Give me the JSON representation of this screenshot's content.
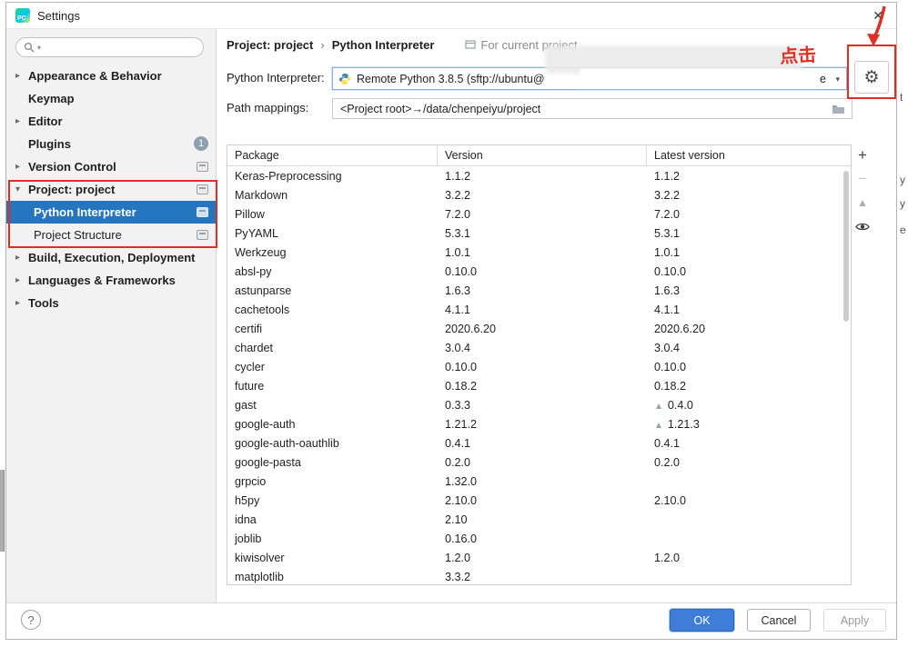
{
  "window": {
    "title": "Settings",
    "logo": "PC"
  },
  "icons": {
    "close": "✕",
    "chevron_collapsed": "▸",
    "chevron_expanded": "▾",
    "combo_arrow": "▾",
    "breadcrumb_sep": "›",
    "gear": "⚙",
    "plus": "+",
    "minus": "−",
    "upgrade": "▲"
  },
  "colors": {
    "selection_blue": "#2675bf",
    "annotation_red": "#df2f25",
    "ok_blue": "#3e7ed9"
  },
  "sidebar": {
    "search_placeholder": "",
    "items": [
      {
        "id": "appearance-behavior",
        "label": "Appearance & Behavior",
        "expandable": true,
        "bold": true
      },
      {
        "id": "keymap",
        "label": "Keymap",
        "bold": true
      },
      {
        "id": "editor",
        "label": "Editor",
        "expandable": true,
        "bold": true
      },
      {
        "id": "plugins",
        "label": "Plugins",
        "bold": true,
        "badge": "1"
      },
      {
        "id": "version-control",
        "label": "Version Control",
        "expandable": true,
        "bold": true,
        "scoped": true
      },
      {
        "id": "project-project",
        "label": "Project: project",
        "expanded": true,
        "bold": true,
        "scoped": true
      },
      {
        "id": "python-interpreter",
        "label": "Python Interpreter",
        "child": true,
        "selected": true,
        "scoped": true
      },
      {
        "id": "project-structure",
        "label": "Project Structure",
        "child": true,
        "scoped": true
      },
      {
        "id": "build-execution-deployment",
        "label": "Build, Execution, Deployment",
        "expandable": true,
        "bold": true
      },
      {
        "id": "languages-frameworks",
        "label": "Languages & Frameworks",
        "expandable": true,
        "bold": true
      },
      {
        "id": "tools",
        "label": "Tools",
        "expandable": true,
        "bold": true
      }
    ]
  },
  "header": {
    "breadcrumb": [
      "Project: project",
      "Python Interpreter"
    ],
    "context_label": "For current project"
  },
  "interpreter": {
    "label": "Python Interpreter:",
    "value": "Remote Python 3.8.5 (sftp://ubuntu@",
    "value_tail": "e"
  },
  "path_mappings": {
    "label": "Path mappings:",
    "value": "<Project root>→/data/chenpeiyu/project"
  },
  "packages": {
    "columns": [
      "Package",
      "Version",
      "Latest version"
    ],
    "rows": [
      {
        "name": "Keras-Preprocessing",
        "version": "1.1.2",
        "latest": "1.1.2"
      },
      {
        "name": "Markdown",
        "version": "3.2.2",
        "latest": "3.2.2"
      },
      {
        "name": "Pillow",
        "version": "7.2.0",
        "latest": "7.2.0"
      },
      {
        "name": "PyYAML",
        "version": "5.3.1",
        "latest": "5.3.1"
      },
      {
        "name": "Werkzeug",
        "version": "1.0.1",
        "latest": "1.0.1"
      },
      {
        "name": "absl-py",
        "version": "0.10.0",
        "latest": "0.10.0"
      },
      {
        "name": "astunparse",
        "version": "1.6.3",
        "latest": "1.6.3"
      },
      {
        "name": "cachetools",
        "version": "4.1.1",
        "latest": "4.1.1"
      },
      {
        "name": "certifi",
        "version": "2020.6.20",
        "latest": "2020.6.20"
      },
      {
        "name": "chardet",
        "version": "3.0.4",
        "latest": "3.0.4"
      },
      {
        "name": "cycler",
        "version": "0.10.0",
        "latest": "0.10.0"
      },
      {
        "name": "future",
        "version": "0.18.2",
        "latest": "0.18.2"
      },
      {
        "name": "gast",
        "version": "0.3.3",
        "latest": "0.4.0",
        "upgrade": true
      },
      {
        "name": "google-auth",
        "version": "1.21.2",
        "latest": "1.21.3",
        "upgrade": true
      },
      {
        "name": "google-auth-oauthlib",
        "version": "0.4.1",
        "latest": "0.4.1"
      },
      {
        "name": "google-pasta",
        "version": "0.2.0",
        "latest": "0.2.0"
      },
      {
        "name": "grpcio",
        "version": "1.32.0",
        "latest": ""
      },
      {
        "name": "h5py",
        "version": "2.10.0",
        "latest": "2.10.0"
      },
      {
        "name": "idna",
        "version": "2.10",
        "latest": ""
      },
      {
        "name": "joblib",
        "version": "0.16.0",
        "latest": ""
      },
      {
        "name": "kiwisolver",
        "version": "1.2.0",
        "latest": "1.2.0"
      },
      {
        "name": "matplotlib",
        "version": "3.3.2",
        "latest": ""
      }
    ]
  },
  "footer": {
    "help": "?",
    "ok": "OK",
    "cancel": "Cancel",
    "apply": "Apply"
  },
  "annotations": {
    "click_label": "点击"
  },
  "background": {
    "fragments": [
      "t",
      "y",
      "y",
      "e"
    ]
  }
}
